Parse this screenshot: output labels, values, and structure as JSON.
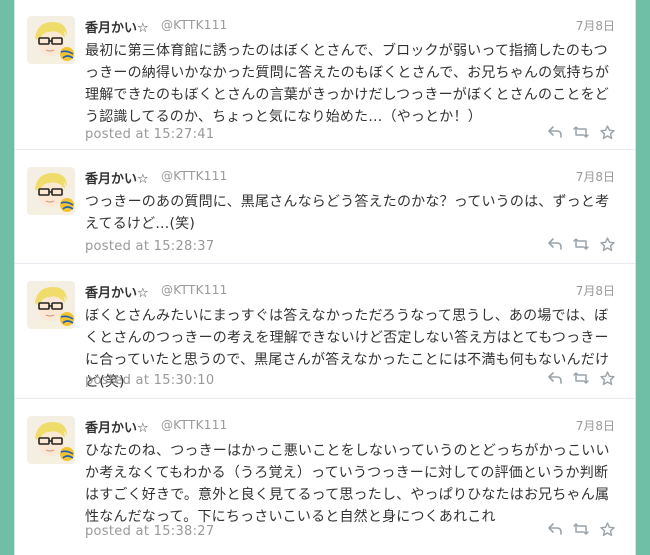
{
  "tweets": [
    {
      "display_name": "香月かい☆",
      "screen_name": "@KTTK111",
      "date": "7月8日",
      "text": "最初に第三体育館に誘ったのはぼくとさんで、ブロックが弱いって指摘したのもつっきーの納得いかなかった質問に答えたのもぼくとさんで、お兄ちゃんの気持ちが理解できたのもぼくとさんの言葉がきっかけだしつっきーがぼくとさんのことをどう認識してるのか、ちょっと気になり始めた…（やっとか！）",
      "posted_at": "posted at 15:27:41"
    },
    {
      "display_name": "香月かい☆",
      "screen_name": "@KTTK111",
      "date": "7月8日",
      "text": "つっきーのあの質問に、黒尾さんならどう答えたのかな？っていうのは、ずっと考えてるけど…(笑)",
      "posted_at": "posted at 15:28:37"
    },
    {
      "display_name": "香月かい☆",
      "screen_name": "@KTTK111",
      "date": "7月8日",
      "text": "ぼくとさんみたいにまっすぐは答えなかっただろうなって思うし、あの場では、ぼくとさんのつっきーの考えを理解できないけど否定しない答え方はとてもつっきーに合っていたと思うので、黒尾さんが答えなかったことには不満も何もないんだけど(笑)",
      "posted_at": "posted at 15:30:10"
    },
    {
      "display_name": "香月かい☆",
      "screen_name": "@KTTK111",
      "date": "7月8日",
      "text": "ひなたのね、つっきーはかっこ悪いことをしないっていうのとどっちがかっこいいか考えなくてもわかる（うろ覚え）っていうつっきーに対しての評価というか判断はすごく好きで。意外と良く見てるって思ったし、やっぱりひなたはお兄ちゃん属性なんだなって。下にちっさいこいると自然と身につくあれこれ",
      "posted_at": "posted at 15:38:27"
    }
  ],
  "icons": {
    "reply": "reply-icon",
    "retweet": "retweet-icon",
    "favorite": "star-icon"
  },
  "colors": {
    "page_background": "#6fbfa6",
    "card_background": "#ffffff",
    "text": "#333333",
    "muted": "#999999"
  }
}
